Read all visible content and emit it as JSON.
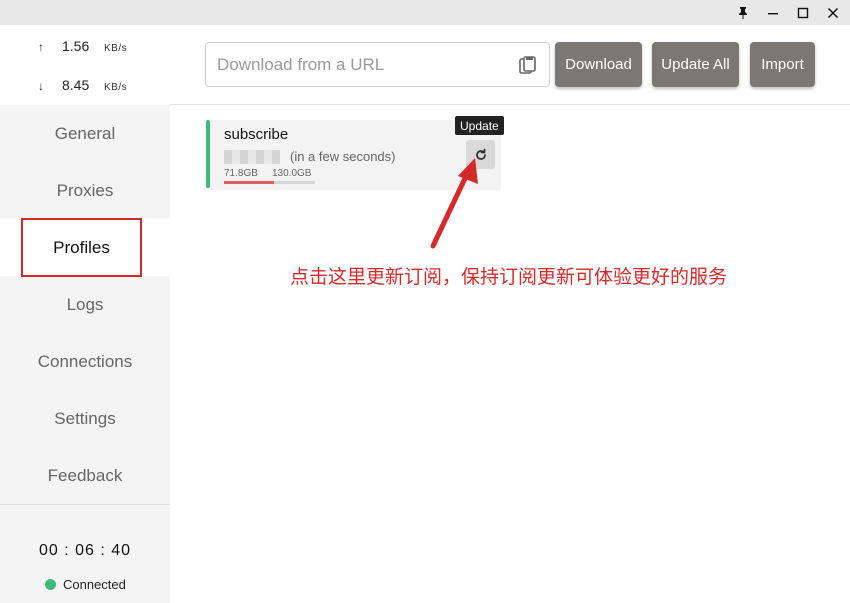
{
  "titlebar": {
    "buttons": [
      {
        "name": "pin-icon",
        "glyph": "📌"
      },
      {
        "name": "minimize-icon",
        "glyph": "—"
      },
      {
        "name": "maximize-icon",
        "glyph": "☐"
      },
      {
        "name": "close-icon",
        "glyph": "✕"
      }
    ]
  },
  "traffic": {
    "up": {
      "arrow": "↑",
      "value": "1.56",
      "unit": "KB/s"
    },
    "down": {
      "arrow": "↓",
      "value": "8.45",
      "unit": "KB/s"
    }
  },
  "sidebar": {
    "items": [
      {
        "label": "General"
      },
      {
        "label": "Proxies"
      },
      {
        "label": "Profiles",
        "active": true
      },
      {
        "label": "Logs"
      },
      {
        "label": "Connections"
      },
      {
        "label": "Settings"
      },
      {
        "label": "Feedback"
      }
    ],
    "timer": "00 : 06 : 40",
    "status": "Connected",
    "status_color": "#3dbb7a"
  },
  "header": {
    "url_placeholder": "Download from a URL",
    "download_label": "Download",
    "update_all_label": "Update All",
    "import_label": "Import"
  },
  "profile": {
    "name": "subscribe",
    "updated": "(in a few seconds)",
    "used": "71.8GB",
    "total": "130.0GB",
    "usage_fraction": 0.552,
    "accent": "#3dbb7a",
    "tooltip": "Update"
  },
  "annotation": {
    "text": "点击这里更新订阅，保持订阅更新可体验更好的服务",
    "color": "#d52a2a"
  }
}
